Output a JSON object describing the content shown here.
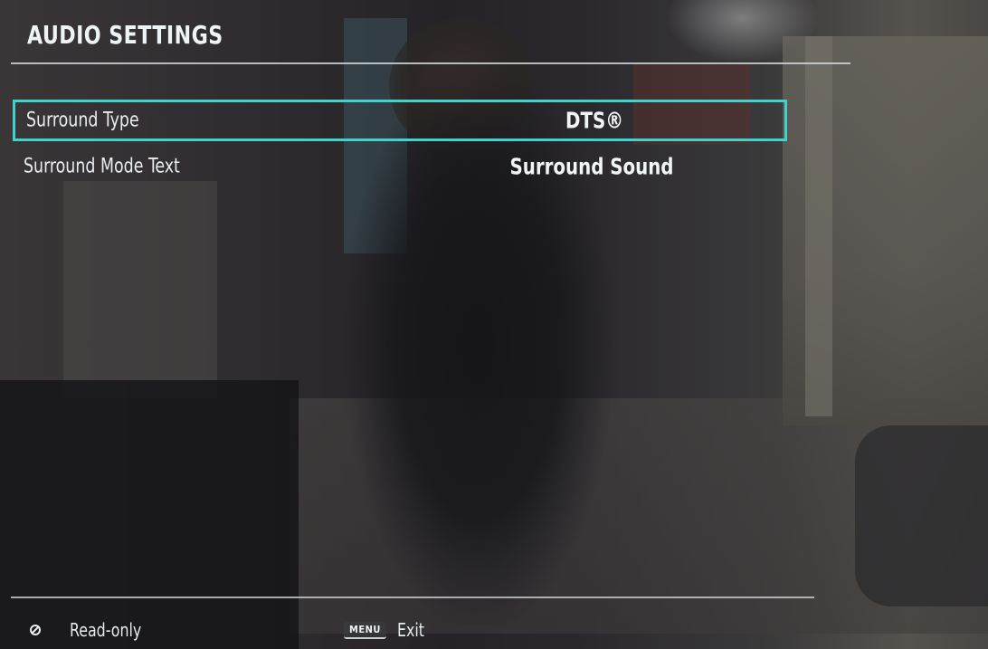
{
  "header": {
    "title": "AUDIO SETTINGS"
  },
  "settings": [
    {
      "label": "Surround Type",
      "value": "DTS®",
      "selected": true
    },
    {
      "label": "Surround Mode Text",
      "value": "Surround Sound",
      "selected": false
    }
  ],
  "footer": {
    "readonly_label": "Read-only",
    "menu_key_label": "MENU",
    "exit_label": "Exit"
  },
  "colors": {
    "highlight_border": "#3fd3cc",
    "text": "#e9eef0"
  },
  "icons": {
    "readonly": "no-entry-icon",
    "menu": "menu-key-icon"
  }
}
